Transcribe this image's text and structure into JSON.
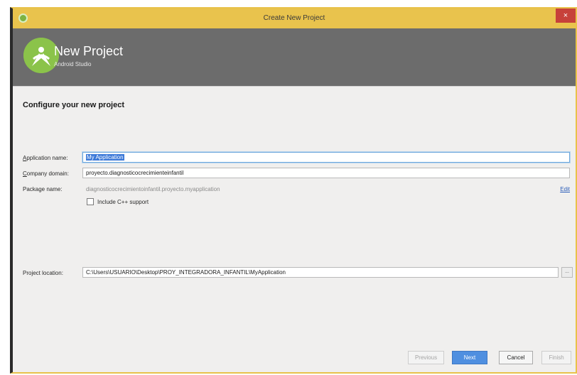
{
  "window": {
    "title": "Create New Project",
    "close_glyph": "×",
    "icon": "android-studio-icon"
  },
  "header": {
    "title": "New Project",
    "subtitle": "Android Studio",
    "logo": "android-studio-logo",
    "background": "#6c6c6c"
  },
  "section": {
    "title": "Configure your new project"
  },
  "form": {
    "application_name": {
      "label_prefix": "A",
      "label_rest": "pplication name:",
      "value": "My Application"
    },
    "company_domain": {
      "label_prefix": "C",
      "label_rest": "ompany domain:",
      "value": "proyecto.diagnosticocrecimienteinfantil"
    },
    "package_name": {
      "label": "Package name:",
      "value": "diagnosticocrecimientoinfantil.proyecto.myapplication",
      "edit_label": "Edit"
    },
    "cpp_support": {
      "label": "Include C++ support",
      "checked": false
    },
    "project_location": {
      "label": "Project location:",
      "value": "C:\\Users\\USUARIO\\Desktop\\PROY_INTEGRADORA_INFANTIL\\MyApplication",
      "browse_label": "..."
    }
  },
  "buttons": {
    "previous": "Previous",
    "next": "Next",
    "cancel": "Cancel",
    "finish": "Finish"
  },
  "colors": {
    "titlebar": "#e9c34d",
    "close": "#c7413a",
    "primary_button": "#4f8fe0",
    "selection": "#3b78d8"
  }
}
